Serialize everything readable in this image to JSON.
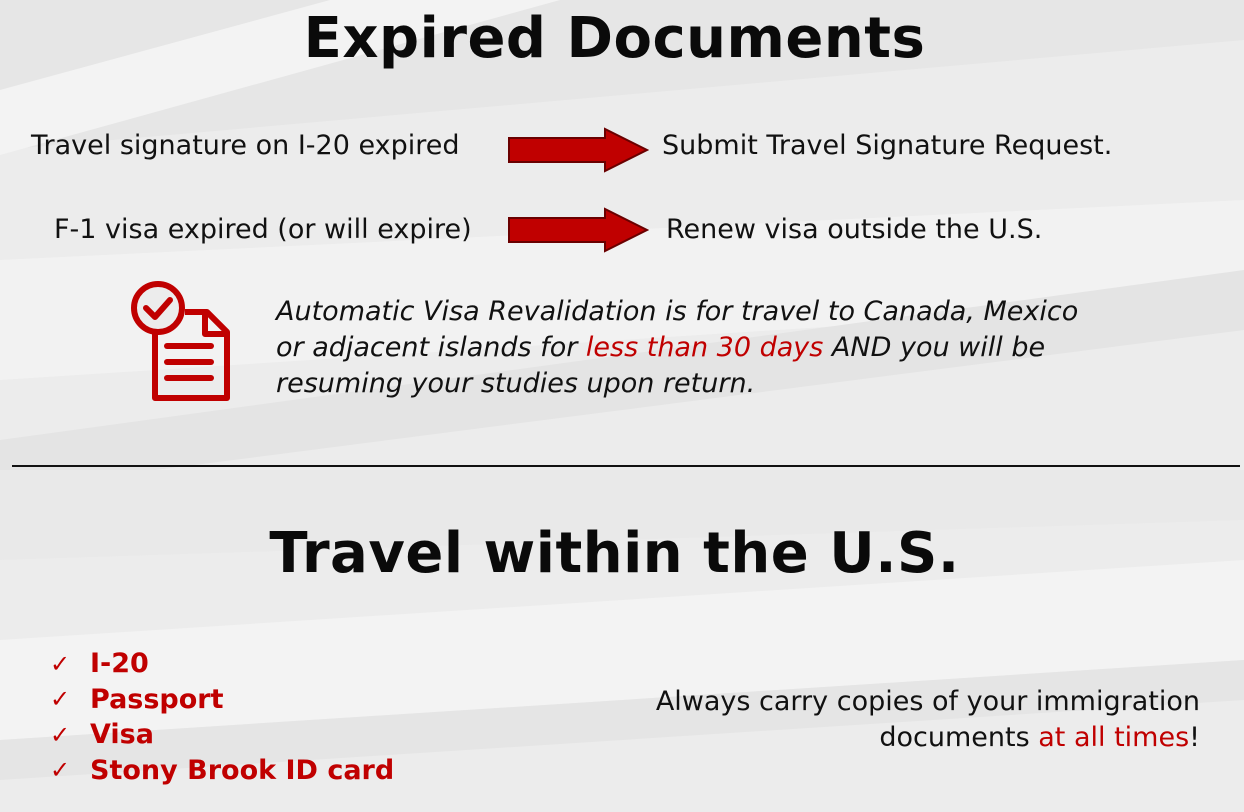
{
  "expired_section": {
    "title": "Expired Documents",
    "rows": [
      {
        "condition": "Travel signature on I-20 expired",
        "action": "Submit Travel Signature Request."
      },
      {
        "condition": "F-1 visa expired (or will expire)",
        "action": "Renew visa outside the U.S."
      }
    ],
    "note": {
      "part1": "Automatic Visa Revalidation is for travel to Canada, Mexico or adjacent islands for ",
      "highlight": "less than 30 days",
      "part2": " AND you will be resuming your studies upon return."
    }
  },
  "domestic_section": {
    "title": "Travel within the U.S.",
    "checklist": [
      {
        "mark": "✓",
        "label": "I-20"
      },
      {
        "mark": "✓",
        "label": "Passport"
      },
      {
        "mark": "✓",
        "label": "Visa"
      },
      {
        "mark": "✓",
        "label": "Stony Brook ID card"
      }
    ],
    "reminder": {
      "part1": "Always carry copies of your immigration documents ",
      "highlight": "at all times",
      "part2": "!"
    }
  },
  "icons": {
    "arrow": "right-arrow-icon",
    "document": "document-check-icon",
    "check": "check-mark-icon"
  },
  "colors": {
    "accent": "#c00000",
    "text": "#111111",
    "background": "#ececec"
  }
}
